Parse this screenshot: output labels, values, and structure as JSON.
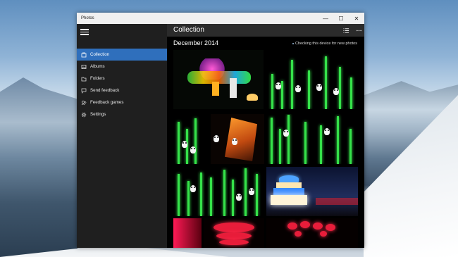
{
  "window": {
    "title": "Photos",
    "controls": {
      "minimize": "—",
      "maximize": "☐",
      "close": "✕"
    }
  },
  "sidebar": {
    "items": [
      {
        "label": "Collection",
        "icon": "collection-icon",
        "active": true
      },
      {
        "label": "Albums",
        "icon": "albums-icon",
        "active": false
      },
      {
        "label": "Folders",
        "icon": "folder-icon",
        "active": false
      },
      {
        "label": "Send feedback",
        "icon": "feedback-icon",
        "active": false
      },
      {
        "label": "Feedback games",
        "icon": "games-icon",
        "active": false
      },
      {
        "label": "Settings",
        "icon": "gear-icon",
        "active": false
      }
    ]
  },
  "main": {
    "heading": "Collection",
    "date_group": "December 2014",
    "status_text": "Checking this device for new photos",
    "tools": [
      "select-icon",
      "more-icon"
    ]
  },
  "colors": {
    "accent": "#2f6fbc",
    "sidebar_bg": "#1f1f1f",
    "mainbar_bg": "#2b2b2b"
  }
}
